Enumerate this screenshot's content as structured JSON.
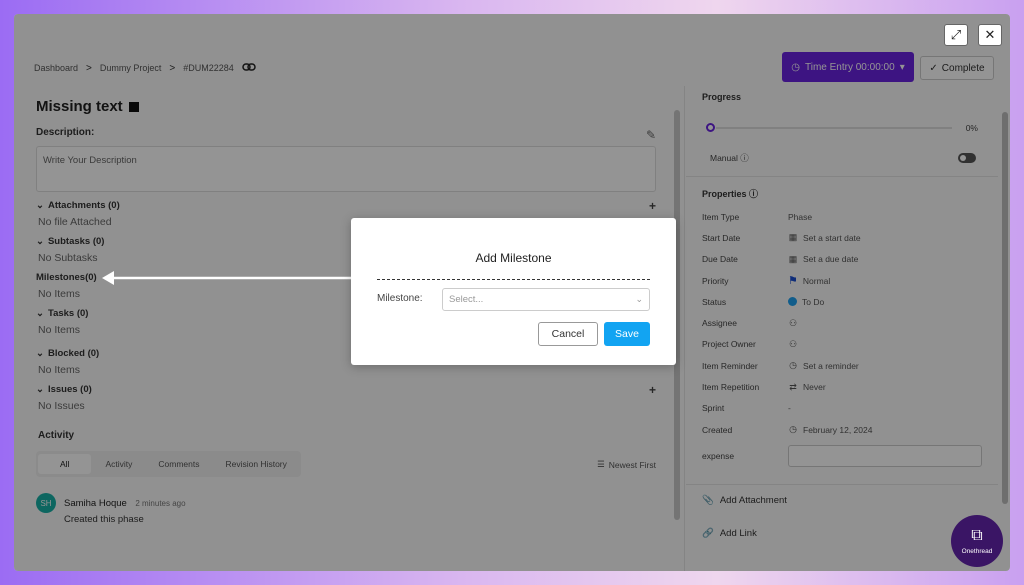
{
  "window_controls": {
    "expand_glyph": "⤢",
    "close_glyph": "✕"
  },
  "breadcrumb": {
    "items": [
      "Dashboard",
      "Dummy Project",
      "#DUM22284"
    ],
    "separator": ">"
  },
  "header": {
    "time_entry_label": "Time Entry 00:00:00",
    "complete_label": "Complete"
  },
  "main": {
    "title": "Missing text",
    "description_label": "Description:",
    "description_placeholder": "Write Your Description",
    "sections": [
      {
        "label": "Attachments (0)",
        "body": "No file Attached"
      },
      {
        "label": "Subtasks (0)",
        "body": "No Subtasks"
      },
      {
        "label": "Milestones(0)",
        "body": "No Items"
      },
      {
        "label": "Tasks (0)",
        "body": "No Items"
      },
      {
        "label": "Blocked (0)",
        "body": "No Items"
      },
      {
        "label": "Issues (0)",
        "body": "No Issues"
      }
    ]
  },
  "activity": {
    "title": "Activity",
    "tabs": [
      "All",
      "Activity",
      "Comments",
      "Revision History"
    ],
    "sort_label": "Newest First",
    "comments": [
      {
        "initials": "SH",
        "name": "Samiha Hoque",
        "time": "2 minutes ago",
        "text": "Created this phase"
      }
    ]
  },
  "sidebar": {
    "progress_label": "Progress",
    "progress_value": "0%",
    "progress_fraction": 0,
    "manual_label": "Manual",
    "properties_label": "Properties",
    "properties": [
      {
        "label": "Item Type",
        "value": "Phase",
        "icon": ""
      },
      {
        "label": "Start Date",
        "value": "Set a start date",
        "icon": "calendar-icon"
      },
      {
        "label": "Due Date",
        "value": "Set a due date",
        "icon": "calendar-icon"
      },
      {
        "label": "Priority",
        "value": "Normal",
        "icon": "flag-icon"
      },
      {
        "label": "Status",
        "value": "To Do",
        "icon": "status-dot-icon"
      },
      {
        "label": "Assignee",
        "value": "",
        "icon": "add-user-icon"
      },
      {
        "label": "Project Owner",
        "value": "",
        "icon": "add-user-icon"
      },
      {
        "label": "Item Reminder",
        "value": "Set a reminder",
        "icon": "clock-icon"
      },
      {
        "label": "Item Repetition",
        "value": "Never",
        "icon": "repeat-icon"
      },
      {
        "label": "Sprint",
        "value": "-",
        "icon": ""
      },
      {
        "label": "Created",
        "value": "February 12, 2024",
        "icon": "clock-icon"
      }
    ],
    "expense_label": "expense",
    "add_attachment_label": "Add Attachment",
    "add_link_label": "Add Link"
  },
  "modal": {
    "title": "Add Milestone",
    "field_label": "Milestone:",
    "select_placeholder": "Select...",
    "cancel_label": "Cancel",
    "save_label": "Save"
  },
  "brand": {
    "name": "Onethread"
  },
  "colors": {
    "accent": "#6a24e0",
    "save": "#12a4f2",
    "avatar": "#18b0a6",
    "status_dot": "#1ea0f0"
  }
}
